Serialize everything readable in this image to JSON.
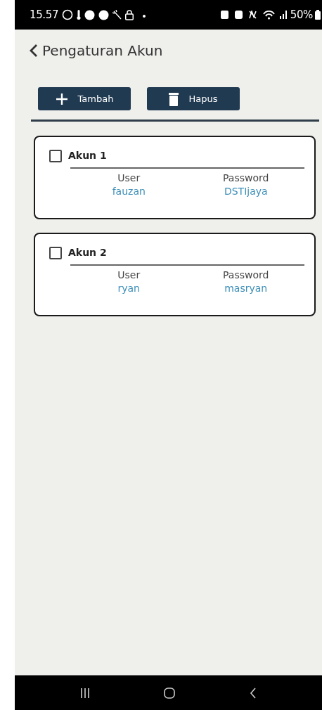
{
  "status_bar": {
    "time": "15.57",
    "battery": "50%"
  },
  "header": {
    "title": "Pengaturan Akun"
  },
  "toolbar": {
    "buttons": [
      {
        "kind": "add",
        "label": "Tambah"
      },
      {
        "kind": "delete",
        "label": "Hapus"
      }
    ]
  },
  "accounts": [
    {
      "title": "Akun 1",
      "checked": false,
      "user_label": "User",
      "user": "fauzan",
      "password_label": "Password",
      "password": "DSTIjaya"
    },
    {
      "title": "Akun 2",
      "checked": false,
      "user_label": "User",
      "user": "ryan",
      "password_label": "Password",
      "password": "masryan"
    }
  ]
}
